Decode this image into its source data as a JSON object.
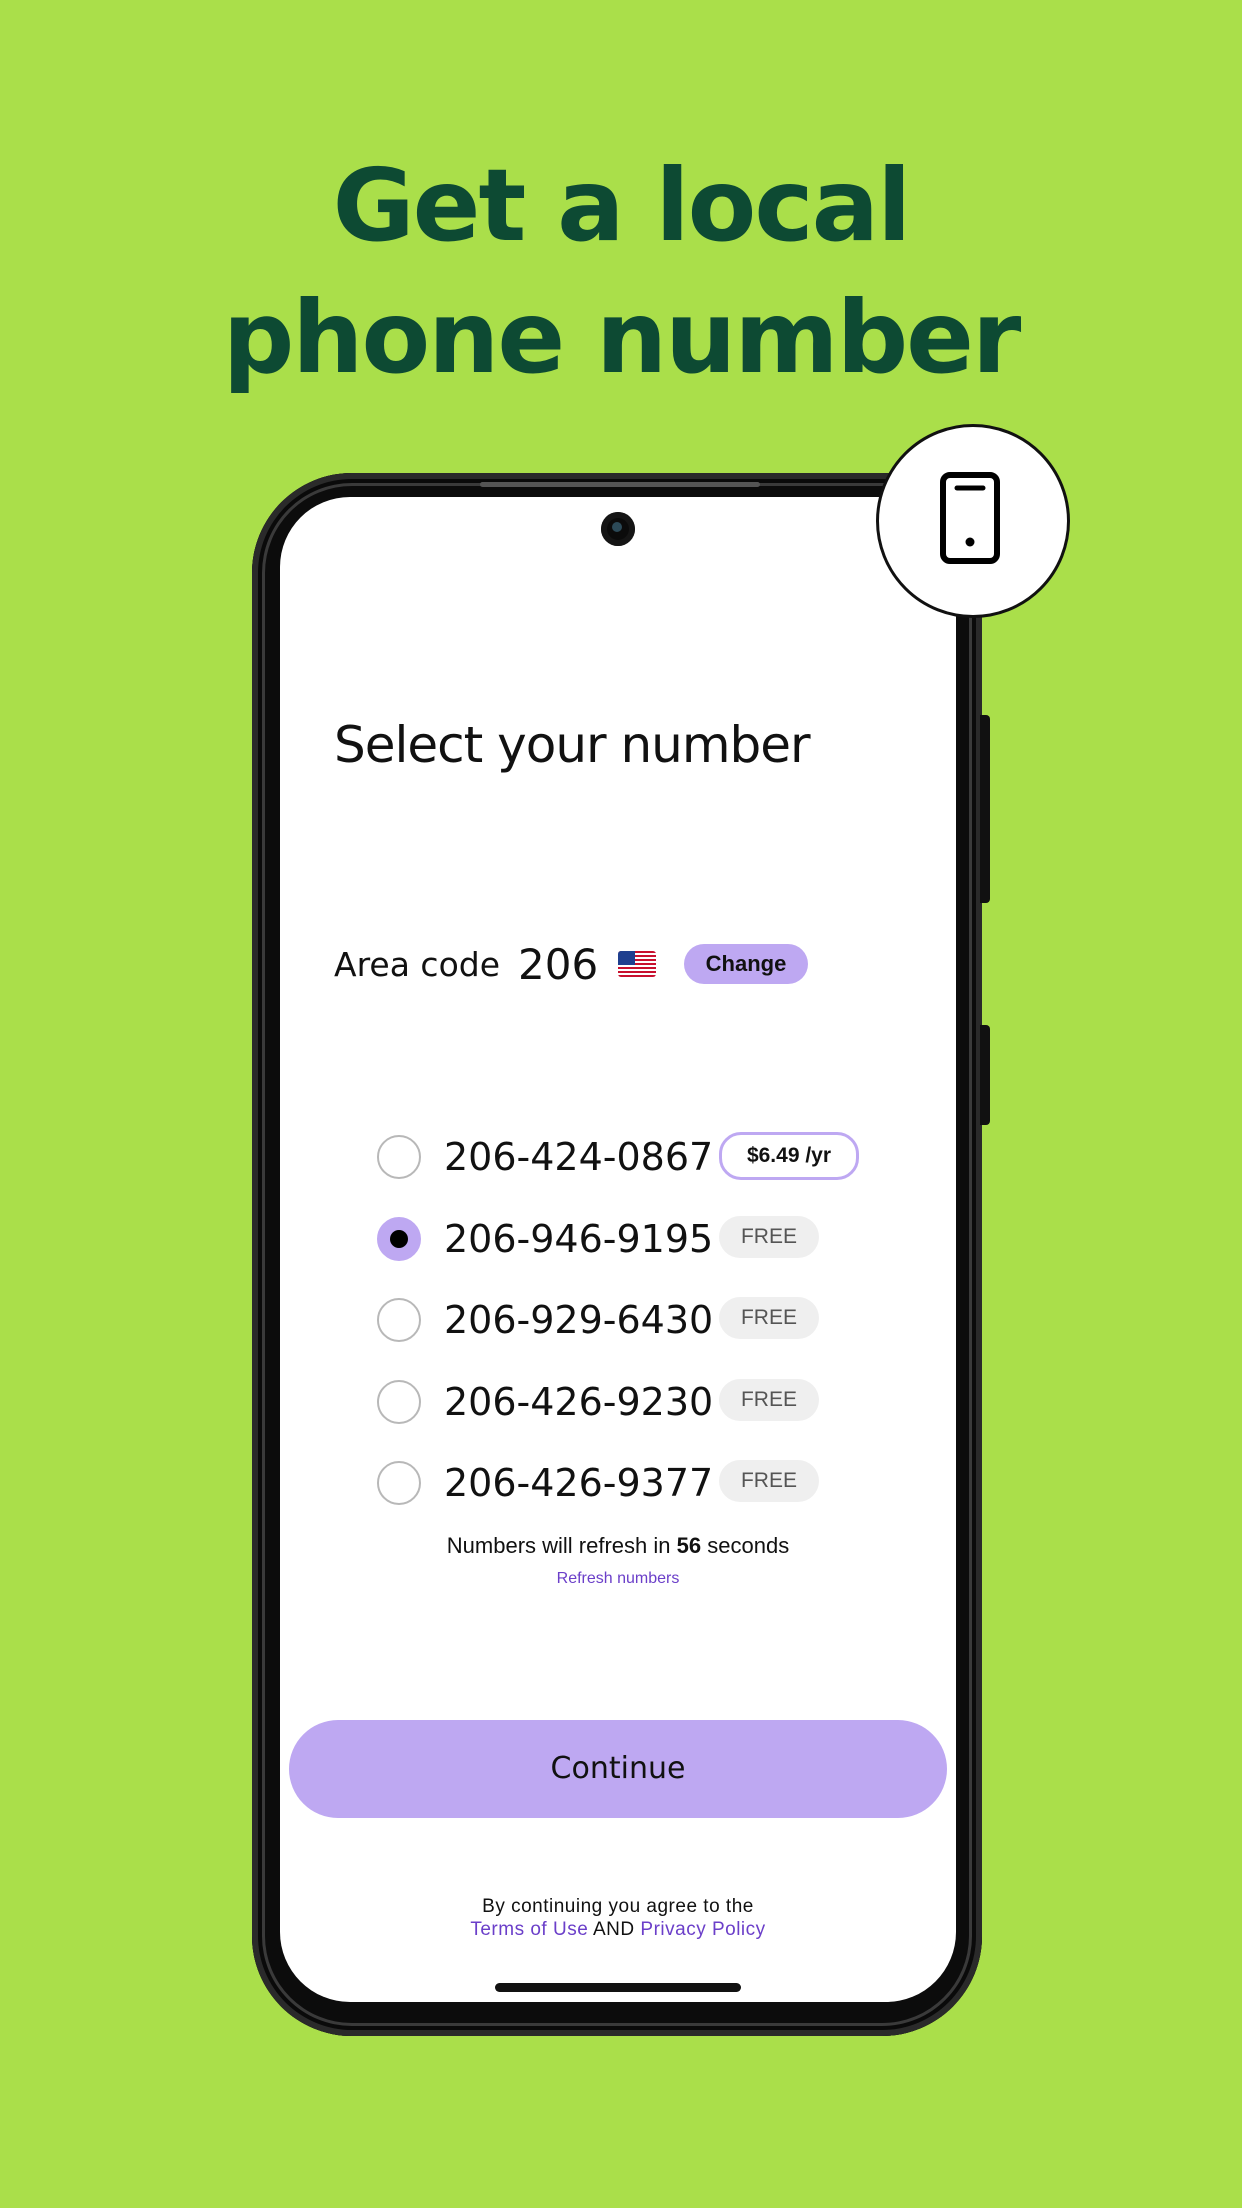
{
  "headline": {
    "line1": "Get a local",
    "line2": "phone number"
  },
  "badge": {
    "icon": "smartphone-icon"
  },
  "screen": {
    "title": "Select your number",
    "area": {
      "label": "Area code",
      "code": "206",
      "flag": "us-flag",
      "change_label": "Change"
    },
    "numbers": [
      {
        "number": "206-424-0867",
        "price": "$6.49 /yr",
        "type": "paid",
        "selected": false
      },
      {
        "number": "206-946-9195",
        "price": "FREE",
        "type": "free",
        "selected": true
      },
      {
        "number": "206-929-6430",
        "price": "FREE",
        "type": "free",
        "selected": false
      },
      {
        "number": "206-426-9230",
        "price": "FREE",
        "type": "free",
        "selected": false
      },
      {
        "number": "206-426-9377",
        "price": "FREE",
        "type": "free",
        "selected": false
      }
    ],
    "refresh": {
      "prefix": "Numbers will refresh in",
      "seconds": "56",
      "suffix": "seconds",
      "link": "Refresh numbers"
    },
    "continue_label": "Continue",
    "legal": {
      "line1": "By continuing you agree to the",
      "terms": "Terms of Use",
      "and": "AND",
      "privacy": "Privacy Policy"
    }
  },
  "colors": {
    "background": "#aadf4a",
    "headline": "#0d4a33",
    "accent": "#bea8f2",
    "link": "#6b3fc9"
  }
}
